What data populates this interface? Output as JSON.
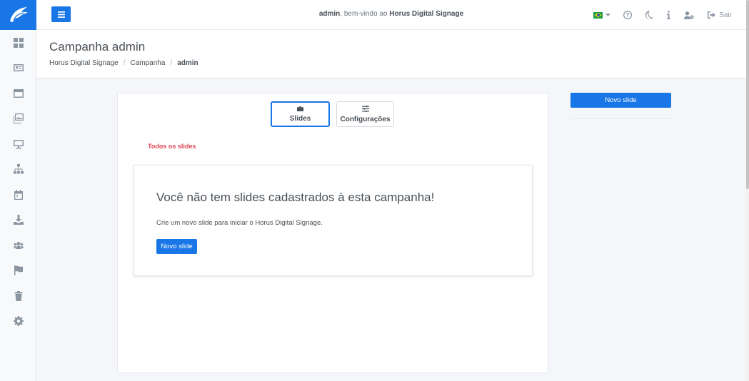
{
  "sidebar": {
    "items": [
      {
        "name": "dashboard-icon"
      },
      {
        "name": "id-card-icon"
      },
      {
        "name": "window-icon"
      },
      {
        "name": "images-icon"
      },
      {
        "name": "monitor-icon"
      },
      {
        "name": "sitemap-icon"
      },
      {
        "name": "calendar-icon"
      },
      {
        "name": "download-icon"
      },
      {
        "name": "users-icon"
      },
      {
        "name": "flag-icon"
      },
      {
        "name": "trash-icon"
      },
      {
        "name": "gear-icon"
      }
    ]
  },
  "topbar": {
    "welcome_user": "admin",
    "welcome_text": ", bem-vindo ao ",
    "app_name": "Horus Digital Signage",
    "logout_label": "Sair"
  },
  "header": {
    "title": "Campanha admin",
    "breadcrumb": [
      "Horus Digital Signage",
      "Campanha",
      "admin"
    ],
    "separator": "/"
  },
  "tabs": {
    "slides_label": "Slides",
    "config_label": "Configurações"
  },
  "content": {
    "section_label": "Todos os slides",
    "empty_title": "Você não tem slides cadastrados à esta campanha!",
    "empty_description": "Crie um novo slide para iniciar o Horus Digital Signage.",
    "new_slide_label": "Novo slide"
  },
  "side_panel": {
    "new_slide_label": "Novo slide"
  },
  "colors": {
    "primary": "#1976e6",
    "accent_red": "#e04455"
  }
}
